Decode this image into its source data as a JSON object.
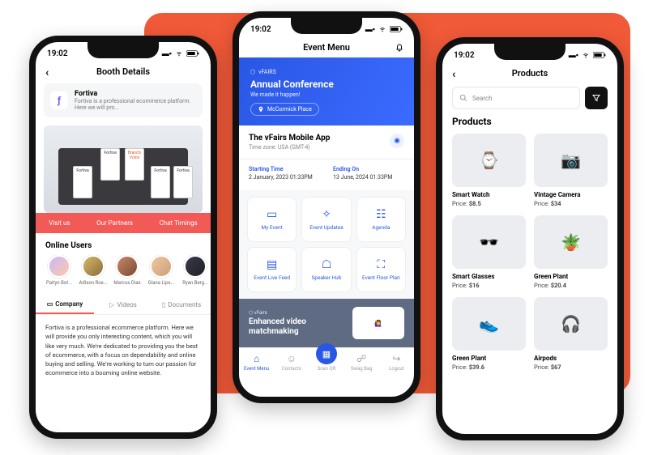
{
  "status_time": "19:02",
  "phone1": {
    "header": "Booth Details",
    "card_title": "Fortiva",
    "card_sub": "Fortiva is a professional ecommerce platform. Here we will pro...",
    "red_tabs": [
      "Visit us",
      "Our Partners",
      "Chat Timings"
    ],
    "online_users_title": "Online Users",
    "users": [
      {
        "name": "Paityn Bot..."
      },
      {
        "name": "Adison Ros..."
      },
      {
        "name": "Marcus Dias"
      },
      {
        "name": "Giana Lips..."
      },
      {
        "name": "Ryan Berg..."
      }
    ],
    "tabs2": [
      "Company",
      "Videos",
      "Documents"
    ],
    "body": "Fortiva is a professional ecommerce platform. Here we will provide you only interesting content, which you will like very much. We're dedicated to providing you the best of ecommerce, with a focus on dependability and online buying and selling. We're working to turn our passion for ecommerce into a booming online website."
  },
  "phone2": {
    "header": "Event Menu",
    "brand": "vFAIRS",
    "hero_title": "Annual Conference",
    "hero_sub": "We made it happen!",
    "location": "McCormick Place",
    "card_title": "The vFairs Mobile App",
    "card_sub": "Time zone: USA (GMT-4)",
    "start_label": "Starting Time",
    "start_value": "2 January, 2023 01:33PM",
    "end_label": "Ending On",
    "end_value": "13 June, 2024 01:33PM",
    "tiles": [
      {
        "label": "My Event"
      },
      {
        "label": "Event Updates"
      },
      {
        "label": "Agenda"
      },
      {
        "label": "Event Live Feed"
      },
      {
        "label": "Speaker Hub"
      },
      {
        "label": "Event Floor Plan"
      }
    ],
    "match_brand": "vFairs",
    "match_title": "Enhanced video matchmaking",
    "nav": [
      "Event Menu",
      "Contacts",
      "Scan QR",
      "Swag Bag",
      "Logout"
    ]
  },
  "phone3": {
    "header": "Products",
    "search_placeholder": "Search",
    "section_title": "Products",
    "price_prefix": "Price: ",
    "products": [
      {
        "title": "Smart Watch",
        "price": "$8.5"
      },
      {
        "title": "Vintage Camera",
        "price": "$34"
      },
      {
        "title": "Smart Glasses",
        "price": "$16"
      },
      {
        "title": "Green Plant",
        "price": "$20.4"
      },
      {
        "title": "Green Plant",
        "price": "$39.6"
      },
      {
        "title": "Airpods",
        "price": "$67"
      }
    ]
  }
}
